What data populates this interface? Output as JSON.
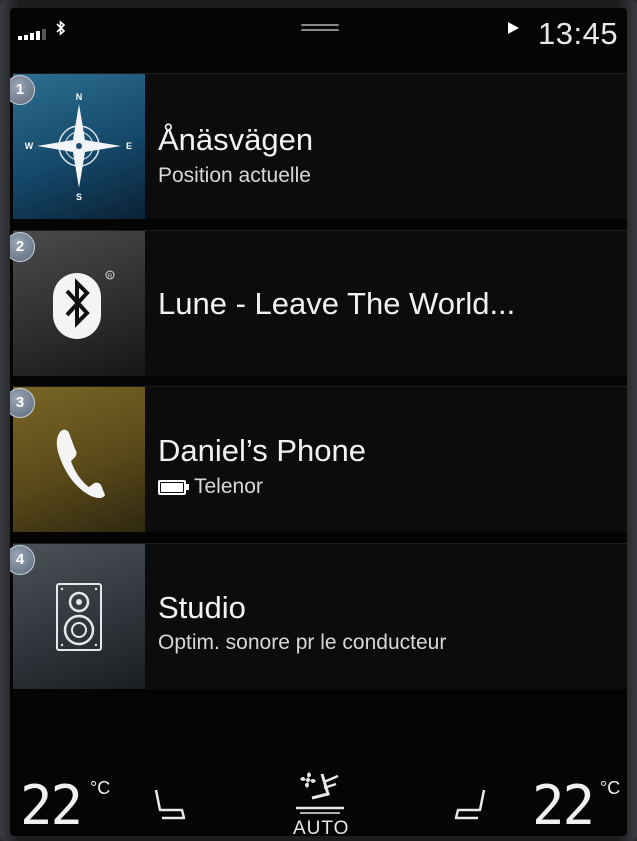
{
  "status_bar": {
    "time": "13:45",
    "icons": [
      "signal-icon",
      "bluetooth-icon",
      "play-icon"
    ]
  },
  "tiles": [
    {
      "number": "1",
      "icon": "compass-icon",
      "title": "Ånäsvägen",
      "subtitle": "Position actuelle",
      "color": "#1d5678",
      "compass": {
        "n": "N",
        "s": "S",
        "e": "E",
        "w": "W"
      }
    },
    {
      "number": "2",
      "icon": "bluetooth-icon",
      "title": "Lune - Leave The World...",
      "subtitle": "",
      "color": "#333437"
    },
    {
      "number": "3",
      "icon": "phone-icon",
      "title": "Daniel’s Phone",
      "subtitle": "Telenor",
      "color": "#6b5a20"
    },
    {
      "number": "4",
      "icon": "speaker-icon",
      "title": "Studio",
      "subtitle": "Optim. sonore pr le conducteur",
      "color": "#3c4348"
    }
  ],
  "climate": {
    "left_temp": "22",
    "right_temp": "22",
    "unit": "°C",
    "auto_label": "AUTO"
  }
}
